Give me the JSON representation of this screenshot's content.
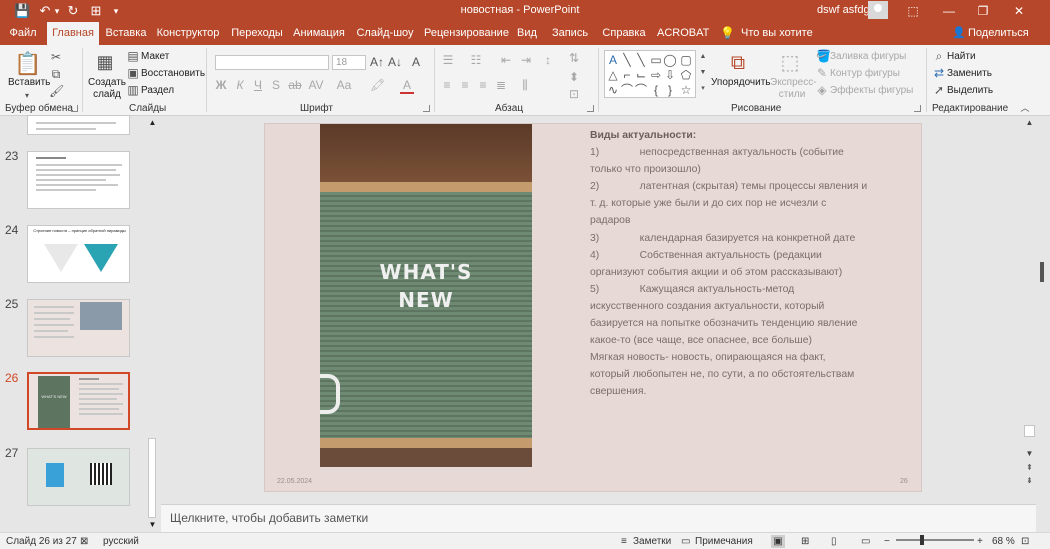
{
  "titlebar": {
    "title": "новостная - PowerPoint",
    "user": "dswf asfdg",
    "qa": {
      "save": "💾",
      "undo": "↶",
      "redo": "↻",
      "start": "⊞",
      "more": "▾"
    },
    "win": {
      "ribbon_opt": "⬚",
      "minimize": "—",
      "restore": "❐",
      "close": "✕"
    }
  },
  "tabs": [
    "Файл",
    "Главная",
    "Вставка",
    "Конструктор",
    "Переходы",
    "Анимация",
    "Слайд-шоу",
    "Рецензирование",
    "Вид",
    "Запись",
    "Справка",
    "ACROBAT"
  ],
  "tellme": "Что вы хотите сделать?",
  "share": "Поделиться",
  "ribbon": {
    "clipboard": {
      "label": "Буфер обмена",
      "paste": "Вставить"
    },
    "slides": {
      "label": "Слайды",
      "new_slide": "Создать слайд",
      "layout": "Макет",
      "reset": "Восстановить",
      "section": "Раздел"
    },
    "font": {
      "label": "Шрифт",
      "size": "18",
      "bold": "Ж",
      "italic": "К",
      "underline": "Ч",
      "strike": "S",
      "strike2": "ab",
      "spacing": "AV",
      "case": "Aa",
      "grow": "A↑",
      "shrink": "A↓",
      "clear": "A"
    },
    "paragraph": {
      "label": "Абзац"
    },
    "drawing": {
      "label": "Рисование",
      "arrange": "Упорядочить",
      "quick_styles": "Экспресс-стили",
      "fill": "Заливка фигуры",
      "outline": "Контур фигуры",
      "effects": "Эффекты фигуры"
    },
    "editing": {
      "label": "Редактирование",
      "find": "Найти",
      "replace": "Заменить",
      "select": "Выделить"
    }
  },
  "thumbnails": [
    {
      "number": "23",
      "title": ""
    },
    {
      "number": "24",
      "title": "Строение новости – принцип обратной пирамиды"
    },
    {
      "number": "25",
      "title": ""
    },
    {
      "number": "26",
      "title": "WHAT'S NEW"
    },
    {
      "number": "27",
      "title": ""
    }
  ],
  "slide": {
    "image_text_line1": "WHAT'S",
    "image_text_line2": "NEW",
    "heading": "Виды актуальности:",
    "lines": [
      "1)              непосредственная актуальность (событие",
      "только что произошло)",
      "2)              латентная (скрытая) темы процессы явления и",
      "т. д. которые уже были и до сих пор не исчезли с",
      "радаров",
      "3)              календарная базируется на конкретной дате",
      "4)              Собственная актуальность (редакции",
      "организуют события акции и об этом рассказывают)",
      "5)              Кажущаяся актуальность-метод",
      "искусственного создания актуальности, который",
      "базируется на попытке обозначить тенденцию явление",
      "какое-то (все чаще, все опаснее, все больше)",
      "Мягкая новость- новость, опирающаяся на факт,",
      "который любопытен не, по сути, а по обстоятельствам",
      "свершения."
    ],
    "date": "22.05.2024",
    "number": "26"
  },
  "notes_placeholder": "Щелкните, чтобы добавить заметки",
  "status": {
    "slide_of": "Слайд 26 из 27",
    "language": "русский",
    "notes": "Заметки",
    "comments": "Примечания",
    "zoom": "68 %"
  },
  "colors": {
    "accent": "#b7472a",
    "selection": "#d24726",
    "slide_bg": "#e6d9d6"
  }
}
